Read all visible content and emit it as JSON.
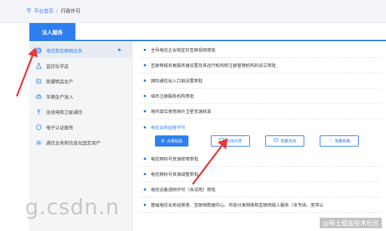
{
  "breadcrumb": {
    "home": "平台首页",
    "separator": "|",
    "current": "行政许可"
  },
  "section_tab": "法人服务",
  "sidebar": {
    "items": [
      {
        "label": "电信和互联网业务",
        "icon": "globe-icon"
      },
      {
        "label": "监控化学品",
        "icon": "flask-icon"
      },
      {
        "label": "民爆物品生产",
        "icon": "explosive-icon"
      },
      {
        "label": "车辆生产准入",
        "icon": "car-icon"
      },
      {
        "label": "无线电和卫星通信",
        "icon": "antenna-icon"
      },
      {
        "label": "电子认证服务",
        "icon": "certificate-icon"
      },
      {
        "label": "通信业务和信息化固定资产",
        "icon": "gear-icon"
      }
    ],
    "active_marker": "▶"
  },
  "main": {
    "items": [
      {
        "label": "主导电信企业制定的互联规则审批"
      },
      {
        "label": "互联网域名根服务器设置及其运行机构和注册管理机构的设立审批"
      },
      {
        "label": "国际通信出入口局设置审批"
      },
      {
        "label": "域名注册服务机构审批"
      },
      {
        "label": "境内单位使用境外卫星资源核准"
      },
      {
        "label": "电信业务经营许可",
        "highlight": true
      },
      {
        "label": "电信网码号资源使用审批"
      },
      {
        "label": "电信网码号资源调整审批"
      },
      {
        "label": "电信设备进网许可（含试用）审批"
      },
      {
        "label": "基础电信业务经营者、互联网数据中心、内容分发网络和互联网接入服务（含专线、宽带以"
      }
    ],
    "actions": [
      {
        "label": "办事指南",
        "icon": "compass-icon"
      },
      {
        "label": "在线办理",
        "icon": "monitor-icon"
      },
      {
        "label": "我要咨询",
        "icon": "chat-icon"
      },
      {
        "label": "我要收藏",
        "icon": "heart-icon"
      }
    ]
  },
  "watermark": {
    "left": "g.csdn.n",
    "right": "@稀土掘金技术社区"
  },
  "colors": {
    "accent": "#2f7ff0",
    "annotation_arrow": "#e53935"
  }
}
